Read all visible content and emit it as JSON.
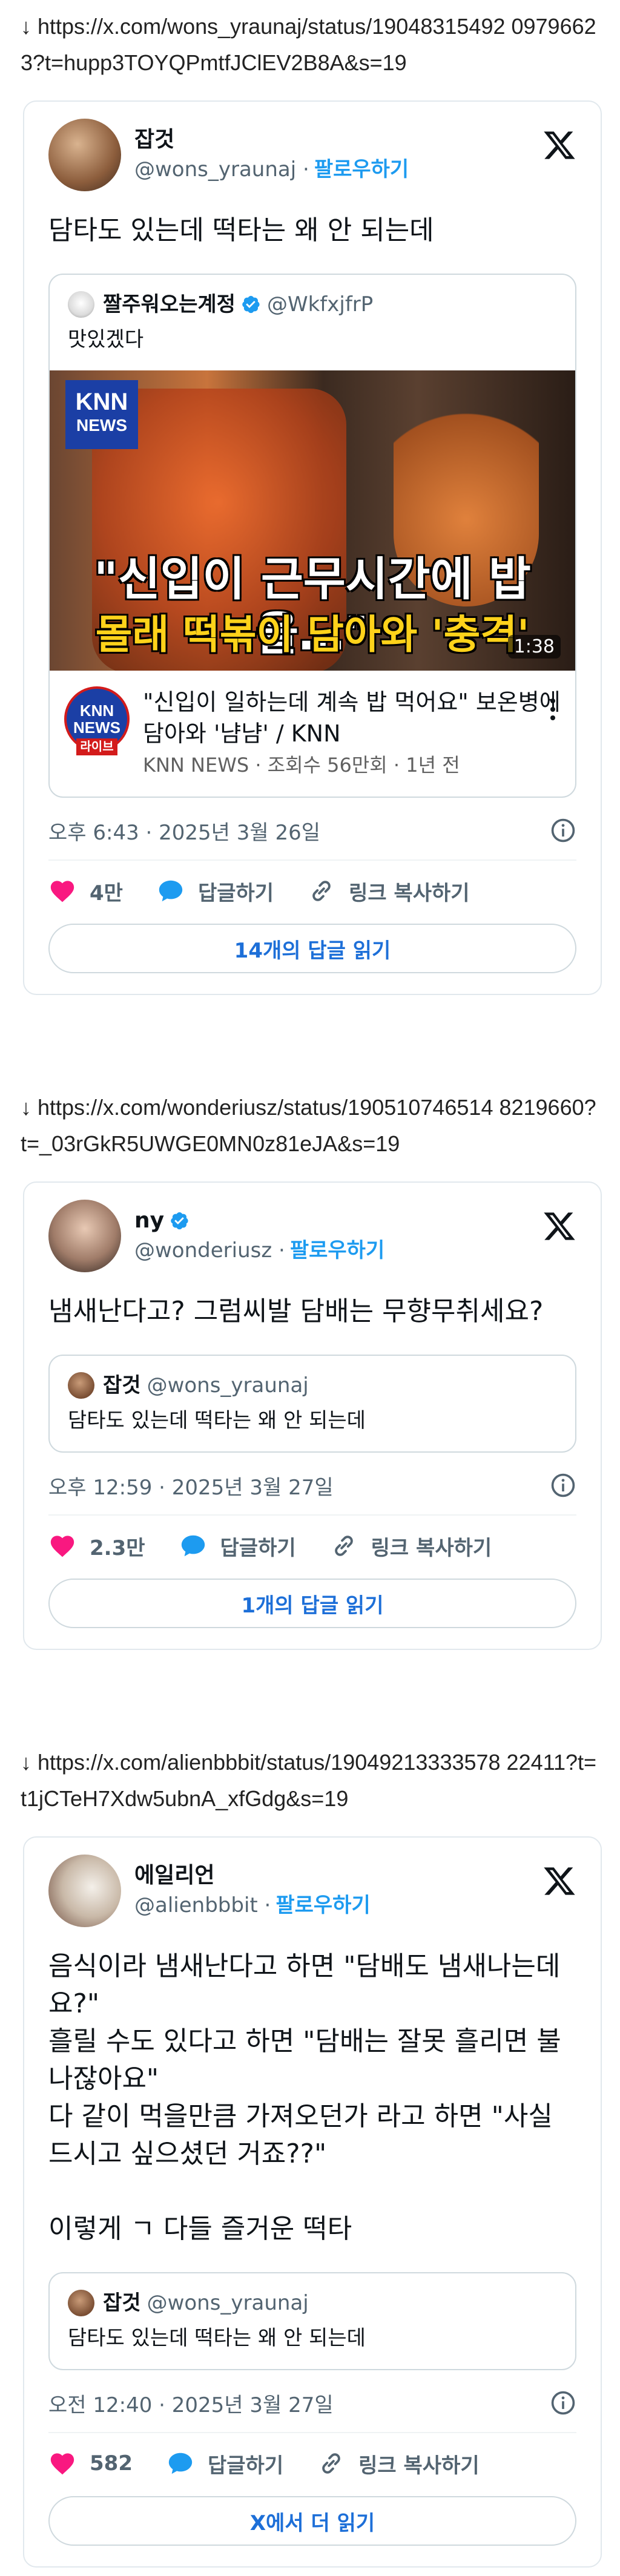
{
  "sections": [
    {
      "url": "↓ https://x.com/wons_yraunaj/status/19048315492 09796623?t=hupp3TOYQPmtfJClEV2B8A&s=19",
      "author": {
        "name": "잡것",
        "handle": "@wons_yraunaj",
        "follow": "팔로우하기"
      },
      "text": "담타도 있는데 떡타는 왜 안 되는데",
      "quote": {
        "name": "짤주워오는계정",
        "handle": "@WkfxjfrP",
        "text": "맛있겠다",
        "media": {
          "logo_top": "KNN",
          "logo_bottom": "NEWS",
          "caption1": "\"신입이 근무시간에 밥을…\"",
          "caption2": "몰래 떡볶이 담아와 '충격'",
          "duration": "1:38"
        },
        "video": {
          "channel_line1": "KNN",
          "channel_line2": "NEWS",
          "channel_live": "라이브",
          "title": "\"신입이 일하는데 계속 밥 먹어요\" 보온병에 담아와 '냠냠' / KNN",
          "meta": "KNN NEWS · 조회수 56만회 · 1년 전"
        }
      },
      "timestamp": "오후 6:43 · 2025년 3월 26일",
      "likes": "4만",
      "reply_label": "답글하기",
      "copy_label": "링크 복사하기",
      "read_more": "14개의 답글 읽기"
    },
    {
      "url": "↓ https://x.com/wonderiusz/status/190510746514 8219660?t=_03rGkR5UWGE0MN0z81eJA&s=19",
      "author": {
        "name": "ny",
        "handle": "@wonderiusz",
        "follow": "팔로우하기"
      },
      "text": "냄새난다고? 그럼씨발 담배는 무향무취세요?",
      "quote": {
        "name": "잡것",
        "handle": "@wons_yraunaj",
        "text": "담타도 있는데 떡타는 왜 안 되는데"
      },
      "timestamp": "오후 12:59 · 2025년 3월 27일",
      "likes": "2.3만",
      "reply_label": "답글하기",
      "copy_label": "링크 복사하기",
      "read_more": "1개의 답글 읽기"
    },
    {
      "url": "↓ https://x.com/alienbbbit/status/19049213333578 22411?t=t1jCTeH7Xdw5ubnA_xfGdg&s=19",
      "author": {
        "name": "에일리언",
        "handle": "@alienbbbit",
        "follow": "팔로우하기"
      },
      "text": "음식이라 냄새난다고 하면 \"담배도 냄새나는데요?\"\n흘릴 수도 있다고 하면 \"담배는 잘못 흘리면 불나잖아요\"\n다 같이 먹을만큼 가져오던가 라고 하면 \"사실 드시고 싶으셨던 거죠??\"\n\n이렇게 ㄱ 다들 즐거운 떡타",
      "quote": {
        "name": "잡것",
        "handle": "@wons_yraunaj",
        "text": "담타도 있는데 떡타는 왜 안 되는데"
      },
      "timestamp": "오전 12:40 · 2025년 3월 27일",
      "likes": "582",
      "reply_label": "답글하기",
      "copy_label": "링크 복사하기",
      "read_more": "X에서 더 읽기"
    }
  ],
  "colors": {
    "like": "#f91880",
    "reply": "#1d9bf0",
    "link": "#1d6fd8",
    "verified": "#1d9bf0"
  },
  "icons": [
    "x-logo-icon",
    "verified-badge-icon",
    "info-icon",
    "heart-icon",
    "reply-bubble-icon",
    "link-icon",
    "more-options-icon"
  ]
}
